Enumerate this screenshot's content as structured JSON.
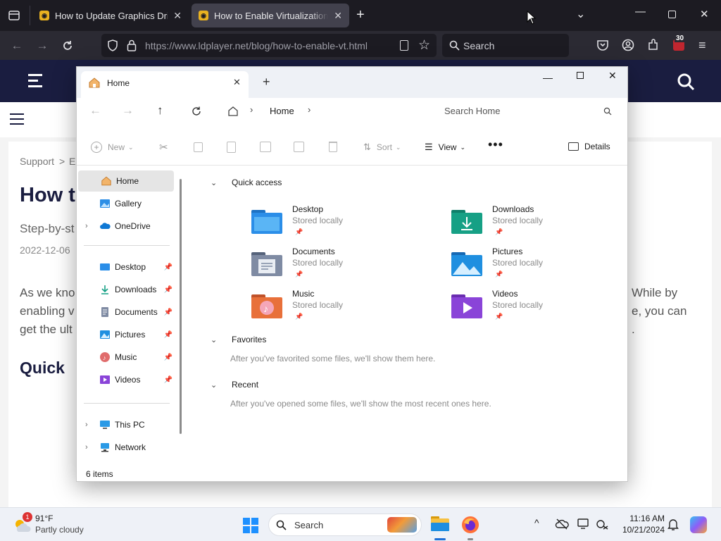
{
  "browser": {
    "tabs": [
      {
        "title": "How to Update Graphics Driver",
        "active": false
      },
      {
        "title": "How to Enable Virtualization (VT)",
        "active": true
      }
    ],
    "url": "https://www.ldplayer.net/blog/how-to-enable-vt.html",
    "search_placeholder": "Search",
    "extension_badge": "30"
  },
  "webpage": {
    "breadcrumb_1": "Support",
    "breadcrumb_2": "E",
    "heading": "How t",
    "subtitle": "Step-by-st",
    "date": "2022-12-06",
    "para_left": [
      "As we kno",
      "enabling v",
      "get the ult"
    ],
    "para_right": [
      "While by",
      "e, you can",
      "."
    ],
    "quick_heading": "Quick"
  },
  "explorer": {
    "tab_title": "Home",
    "address_crumb": "Home",
    "search_placeholder": "Search Home",
    "toolbar": {
      "new": "New",
      "sort": "Sort",
      "view": "View",
      "details": "Details"
    },
    "sidebar": {
      "top": [
        "Home",
        "Gallery",
        "OneDrive"
      ],
      "pinned": [
        "Desktop",
        "Downloads",
        "Documents",
        "Pictures",
        "Music",
        "Videos"
      ],
      "bottom": [
        "This PC",
        "Network"
      ]
    },
    "quick_access_title": "Quick access",
    "quick_access": [
      {
        "name": "Desktop",
        "sub": "Stored locally",
        "color": "#2b8ee8"
      },
      {
        "name": "Downloads",
        "sub": "Stored locally",
        "color": "#16a085"
      },
      {
        "name": "Documents",
        "sub": "Stored locally",
        "color": "#6f7f99"
      },
      {
        "name": "Pictures",
        "sub": "Stored locally",
        "color": "#1f8fe0"
      },
      {
        "name": "Music",
        "sub": "Stored locally",
        "color": "#e8703a"
      },
      {
        "name": "Videos",
        "sub": "Stored locally",
        "color": "#8a44d8"
      }
    ],
    "favorites_title": "Favorites",
    "favorites_empty": "After you've favorited some files, we'll show them here.",
    "recent_title": "Recent",
    "recent_empty": "After you've opened some files, we'll show the most recent ones here.",
    "status": "6 items"
  },
  "taskbar": {
    "temperature": "91°F",
    "weather": "Partly cloudy",
    "weather_badge": "1",
    "search": "Search",
    "time": "11:16 AM",
    "date": "10/21/2024"
  }
}
